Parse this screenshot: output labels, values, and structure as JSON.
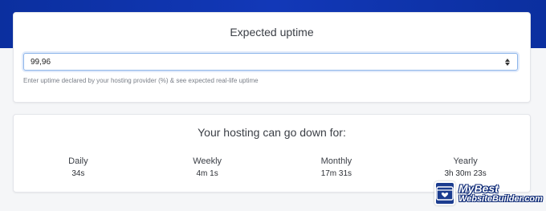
{
  "uptime": {
    "title": "Expected uptime",
    "select_value": "99,96",
    "hint": "Enter uptime declared by your hosting provider (%) & see expected real-life uptime"
  },
  "downtime": {
    "title": "Your hosting can go down for:",
    "periods": [
      {
        "label": "Daily",
        "value": "34s"
      },
      {
        "label": "Weekly",
        "value": "4m 1s"
      },
      {
        "label": "Monthly",
        "value": "17m 31s"
      },
      {
        "label": "Yearly",
        "value": "3h 30m 23s"
      }
    ]
  },
  "logo": {
    "line1": "MyBest",
    "line2": "WebsiteBuilder.com",
    "icon": "browser-heart-icon"
  },
  "colors": {
    "band": "#0b2f9f",
    "focus_border": "#8eb6ea"
  }
}
